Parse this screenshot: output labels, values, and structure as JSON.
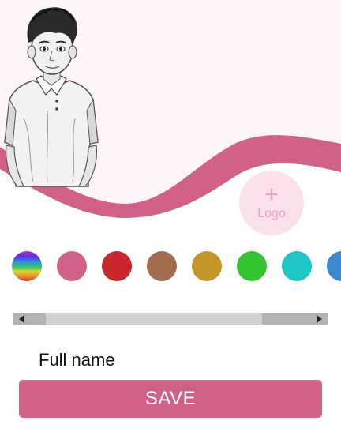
{
  "logo_button": {
    "plus": "+",
    "label": "Logo"
  },
  "color_swatches": [
    {
      "name": "rainbow",
      "color": "rainbow"
    },
    {
      "name": "pink",
      "color": "#d16189"
    },
    {
      "name": "red",
      "color": "#c9262b"
    },
    {
      "name": "brown",
      "color": "#a46c4e"
    },
    {
      "name": "mustard",
      "color": "#c4952a"
    },
    {
      "name": "green",
      "color": "#33c430"
    },
    {
      "name": "teal",
      "color": "#1ec5c5"
    },
    {
      "name": "blue",
      "color": "#3d8ad3"
    }
  ],
  "form": {
    "full_name_label": "Full name"
  },
  "save_button": {
    "label": "SAVE"
  },
  "colors": {
    "accent": "#d16189",
    "hero_bg": "#fdf5f8",
    "logo_bg": "#fbe1ec"
  }
}
